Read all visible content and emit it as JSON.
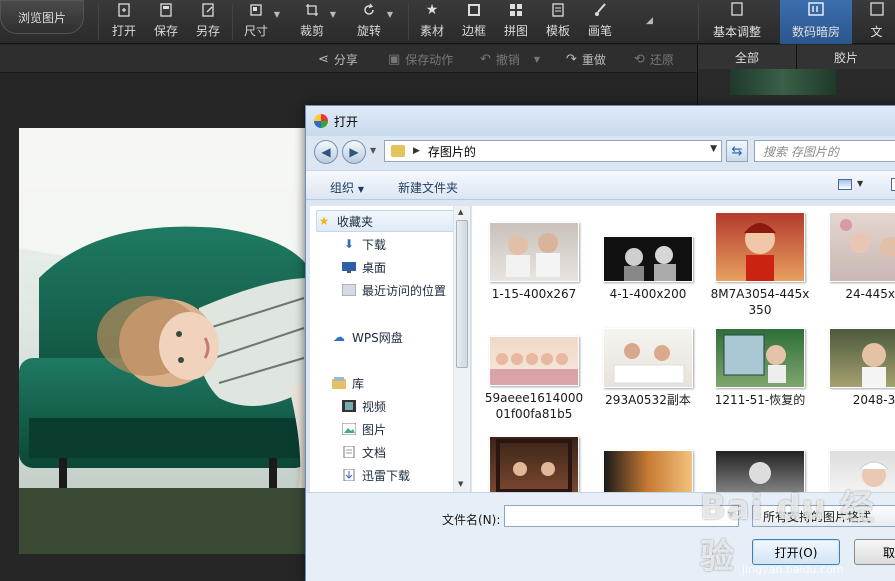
{
  "app": {
    "browse_button": "浏览图片",
    "tools": [
      {
        "label": "打开"
      },
      {
        "label": "保存"
      },
      {
        "label": "另存"
      },
      {
        "label": "尺寸"
      },
      {
        "label": "裁剪"
      },
      {
        "label": "旋转"
      },
      {
        "label": "素材"
      },
      {
        "label": "边框"
      },
      {
        "label": "拼图"
      },
      {
        "label": "模板"
      },
      {
        "label": "画笔"
      }
    ],
    "tabs": [
      {
        "label": "基本调整"
      },
      {
        "label": "数码暗房"
      },
      {
        "label": "文"
      }
    ],
    "actions": {
      "share": "分享",
      "save_action": "保存动作",
      "undo": "撤销",
      "redo": "重做",
      "restore": "还原"
    },
    "right_panel_tabs": [
      "全部",
      "胶片"
    ]
  },
  "dialog": {
    "title": "打开",
    "path": "存图片的",
    "search_placeholder": "搜索 存图片的",
    "organize": "组织",
    "new_folder": "新建文件夹",
    "nav": {
      "favorites": "收藏夹",
      "downloads": "下载",
      "desktop": "桌面",
      "recent": "最近访问的位置",
      "wps": "WPS网盘",
      "library": "库",
      "videos": "视频",
      "pictures": "图片",
      "documents": "文档",
      "thunder": "迅雷下载"
    },
    "files": [
      {
        "name": "1-15-400x267"
      },
      {
        "name": "4-1-400x200"
      },
      {
        "name": "8M7A3054-445x350"
      },
      {
        "name": "24-445x3"
      },
      {
        "name": "59aeee161400001f00fa81b5"
      },
      {
        "name": "293A0532副本"
      },
      {
        "name": "1211-51-恢复的"
      },
      {
        "name": "2048-3"
      },
      {
        "name": ""
      },
      {
        "name": ""
      },
      {
        "name": ""
      },
      {
        "name": ""
      }
    ],
    "filename_label": "文件名(N):",
    "filename_value": "",
    "filetype": "所有支持的图片格式",
    "open_button": "打开(O)",
    "cancel_button": "取"
  },
  "watermark": {
    "main": "Bai du 经验",
    "sub": "jingyan.baidu.com"
  }
}
